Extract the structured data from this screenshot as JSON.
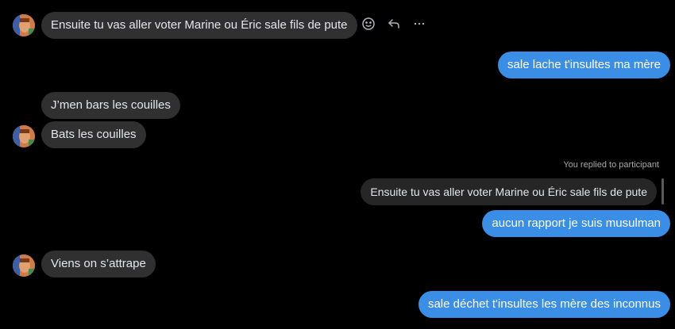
{
  "messages": {
    "m1": "Ensuite tu vas aller voter Marine ou Éric sale fils de pute",
    "m2": "sale lache t'insultes ma mère",
    "m3": "J’men bars les couilles",
    "m4": "Bats les couilles",
    "reply_label": "You replied to participant",
    "reply_quote": "Ensuite tu vas aller voter Marine ou Éric sale fils de pute",
    "m5": "aucun rapport je suis musulman",
    "m6": "Viens on s’attrape",
    "m7": "sale déchet t'insultes les mère des inconnus"
  },
  "icons": {
    "react": "smiley-icon",
    "reply": "reply-icon",
    "more": "more-icon"
  },
  "colors": {
    "background": "#000000",
    "incoming_bubble": "#303030",
    "outgoing_bubble": "#3a8ee6",
    "reply_preview": "#262626"
  }
}
